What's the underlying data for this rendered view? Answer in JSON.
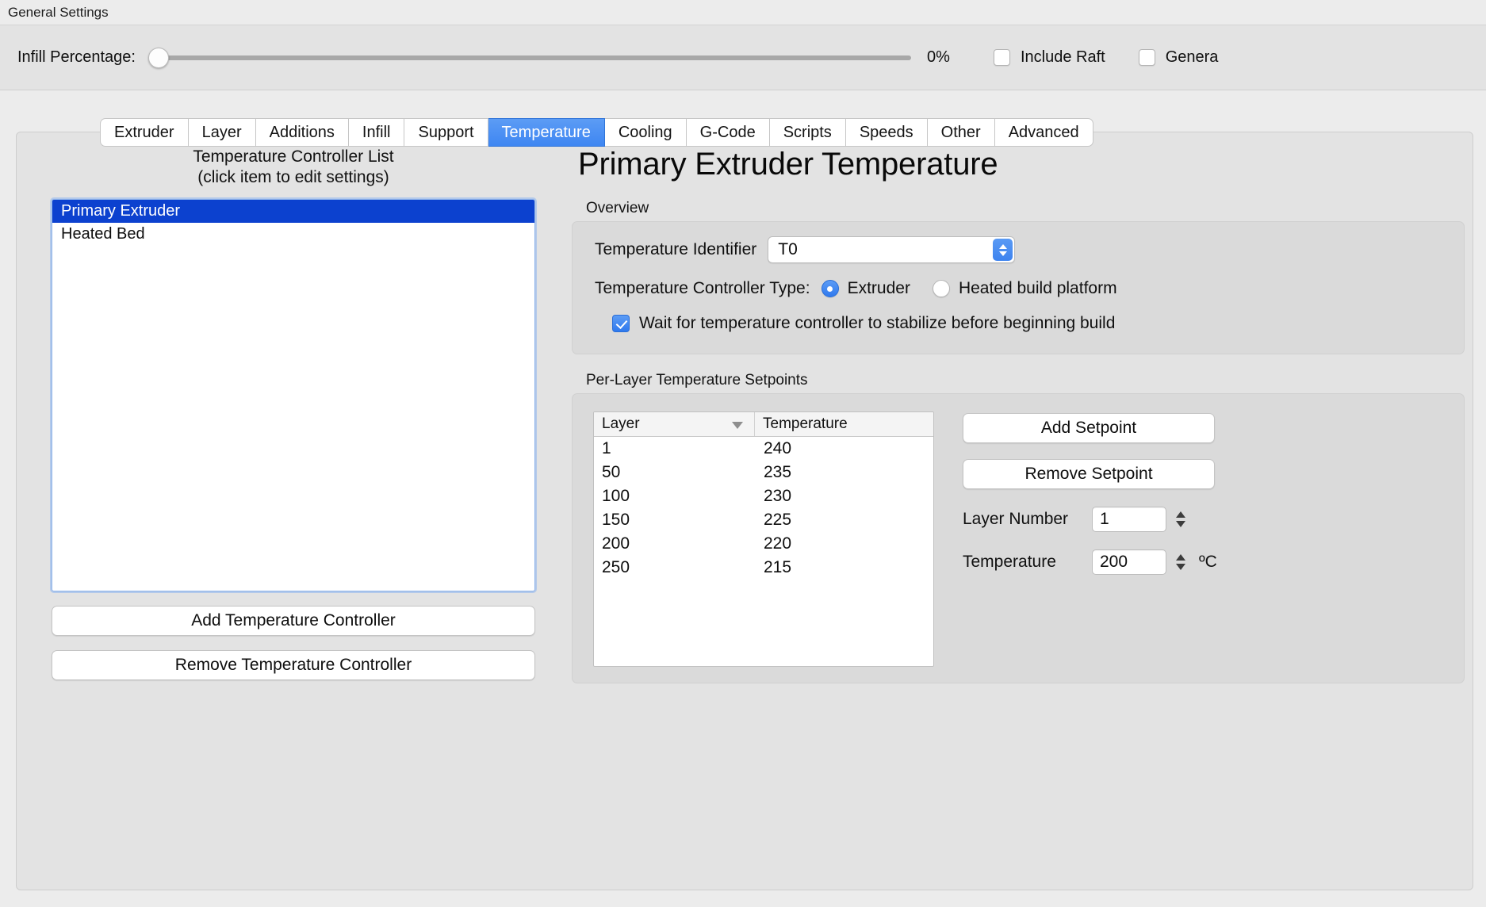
{
  "general_settings": {
    "title": "General Settings",
    "infill_label": "Infill Percentage:",
    "infill_value": "0%",
    "infill_percent": 0,
    "include_raft_label": "Include Raft",
    "generate_label": "Genera"
  },
  "tabs": [
    {
      "label": "Extruder",
      "active": false
    },
    {
      "label": "Layer",
      "active": false
    },
    {
      "label": "Additions",
      "active": false
    },
    {
      "label": "Infill",
      "active": false
    },
    {
      "label": "Support",
      "active": false
    },
    {
      "label": "Temperature",
      "active": true
    },
    {
      "label": "Cooling",
      "active": false
    },
    {
      "label": "G-Code",
      "active": false
    },
    {
      "label": "Scripts",
      "active": false
    },
    {
      "label": "Speeds",
      "active": false
    },
    {
      "label": "Other",
      "active": false
    },
    {
      "label": "Advanced",
      "active": false
    }
  ],
  "controller_list": {
    "caption_line1": "Temperature Controller List",
    "caption_line2": "(click item to edit settings)",
    "items": [
      {
        "label": "Primary Extruder",
        "selected": true
      },
      {
        "label": "Heated Bed",
        "selected": false
      }
    ],
    "add_button": "Add Temperature Controller",
    "remove_button": "Remove Temperature Controller"
  },
  "detail": {
    "title": "Primary Extruder Temperature",
    "overview": {
      "group_label": "Overview",
      "identifier_label": "Temperature Identifier",
      "identifier_value": "T0",
      "controller_type_label": "Temperature Controller Type:",
      "radio_extruder": "Extruder",
      "radio_heated_bed": "Heated build platform",
      "selected_type": "Extruder",
      "wait_checkbox_label": "Wait for temperature controller to stabilize before beginning build",
      "wait_checked": true
    },
    "setpoints": {
      "group_label": "Per-Layer Temperature Setpoints",
      "columns": [
        "Layer",
        "Temperature"
      ],
      "sorted_column": "Layer",
      "rows": [
        {
          "layer": "1",
          "temperature": "240"
        },
        {
          "layer": "50",
          "temperature": "235"
        },
        {
          "layer": "100",
          "temperature": "230"
        },
        {
          "layer": "150",
          "temperature": "225"
        },
        {
          "layer": "200",
          "temperature": "220"
        },
        {
          "layer": "250",
          "temperature": "215"
        }
      ],
      "add_button": "Add Setpoint",
      "remove_button": "Remove Setpoint",
      "layer_number_label": "Layer Number",
      "layer_number_value": "1",
      "temperature_label": "Temperature",
      "temperature_value": "200",
      "temperature_unit": "ºC"
    }
  },
  "colors": {
    "accent_blue": "#3e86f2",
    "selection_blue": "#0c41cf",
    "window_bg": "#ececec",
    "panel_bg": "#e3e3e3",
    "group_bg": "#dadada"
  }
}
